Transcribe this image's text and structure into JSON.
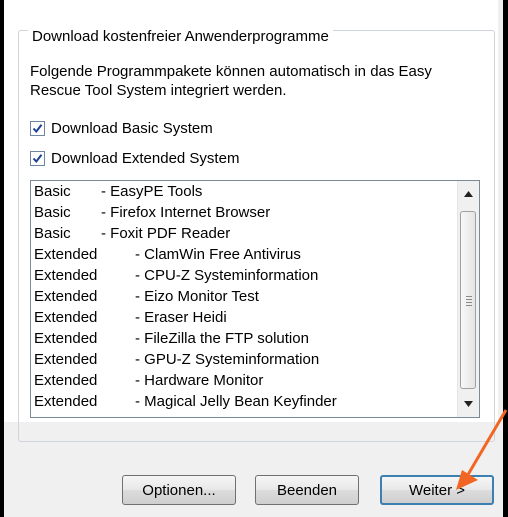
{
  "group": {
    "legend": "Download kostenfreier Anwenderprogramme"
  },
  "description": {
    "line1": "Folgende Programmpakete können automatisch in das Easy",
    "line2": "Rescue Tool System integriert werden."
  },
  "checkboxes": [
    {
      "label": "Download Basic System",
      "checked": true
    },
    {
      "label": "Download Extended System",
      "checked": true
    }
  ],
  "programs": [
    {
      "category": "Basic",
      "name": "- EasyPE Tools"
    },
    {
      "category": "Basic",
      "name": "- Firefox Internet Browser"
    },
    {
      "category": "Basic",
      "name": "- Foxit PDF Reader"
    },
    {
      "category": "Extended",
      "name": "- ClamWin Free Antivirus"
    },
    {
      "category": "Extended",
      "name": "- CPU-Z Systeminformation"
    },
    {
      "category": "Extended",
      "name": "- Eizo Monitor Test"
    },
    {
      "category": "Extended",
      "name": "- Eraser Heidi"
    },
    {
      "category": "Extended",
      "name": "- FileZilla the FTP solution"
    },
    {
      "category": "Extended",
      "name": "- GPU-Z Systeminformation"
    },
    {
      "category": "Extended",
      "name": "- Hardware Monitor"
    },
    {
      "category": "Extended",
      "name": "- Magical Jelly Bean Keyfinder"
    }
  ],
  "buttons": {
    "options": "Optionen...",
    "quit": "Beenden",
    "next": "Weiter >"
  },
  "colors": {
    "annotation_arrow": "#f26522",
    "default_button_border": "#3c7fb1"
  }
}
